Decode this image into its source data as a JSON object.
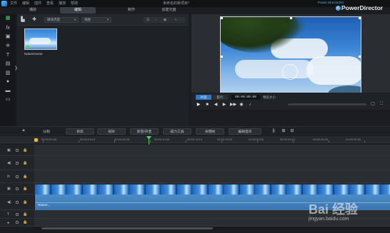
{
  "window": {
    "menu": [
      "文件",
      "编辑",
      "插件",
      "查看",
      "播放",
      "帮助"
    ],
    "title": "未命名的新项目*",
    "brand_sub": "Power Director(R)",
    "brand": "PowerDirector"
  },
  "mode_tabs": [
    {
      "label": "捕获",
      "active": false
    },
    {
      "label": "编辑",
      "active": true
    },
    {
      "label": "制作",
      "active": false
    },
    {
      "label": "创建光盘",
      "active": false
    }
  ],
  "library": {
    "filter_select": "媒体内容",
    "type_select": "视频",
    "items": [
      {
        "name": "Naturescene"
      }
    ]
  },
  "preview": {
    "mode_clip": "片段",
    "mode_movie": "影片",
    "timecode": "00:00:00:00",
    "quality": "预览大小"
  },
  "edit_toolbar": {
    "buttons": [
      "分割",
      "修剪",
      "视效",
      "影音/声音",
      "威力工具",
      "关键帧",
      "编辑音声"
    ]
  },
  "timeline": {
    "ruler_labels": [
      "00:00:00:00",
      "00:00:03:10",
      "00:00:06:20",
      "00:00:10:00",
      "00:00:13:10",
      "00:00:16:20",
      "00:00:20:00",
      "00:00:23:10",
      "00:00:26:20",
      "00:00:30:00"
    ],
    "audio_clip_label": "Nature..."
  },
  "watermark": {
    "text": "Bai 经验",
    "sub": "jingyan.baidu.com"
  },
  "colors": {
    "accent_green": "#49d46a",
    "accent_blue": "#3578c4",
    "brand_blue": "#4fa8e8"
  }
}
